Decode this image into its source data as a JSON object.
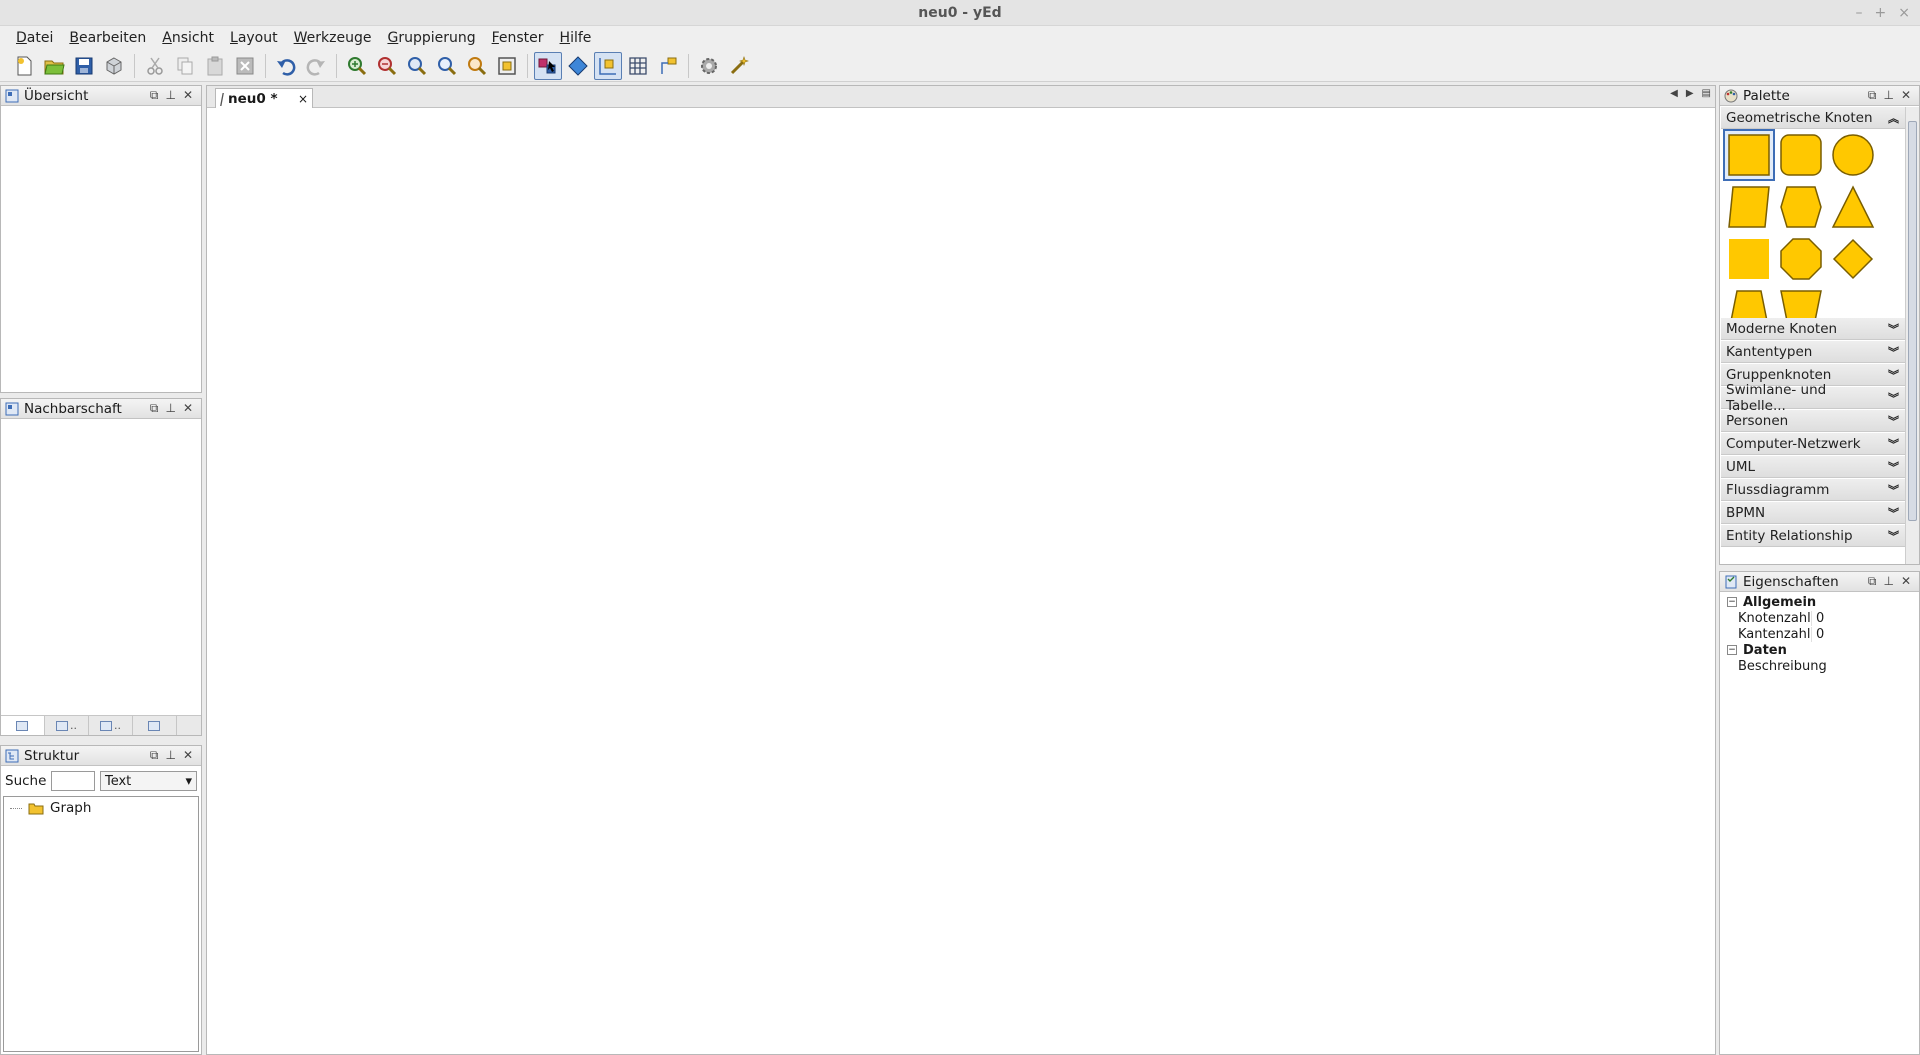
{
  "window": {
    "title": "neu0 - yEd",
    "controls": [
      "–",
      "+",
      "×"
    ]
  },
  "menu": [
    {
      "mn": "D",
      "rest": "atei"
    },
    {
      "mn": "B",
      "rest": "earbeiten"
    },
    {
      "mn": "A",
      "rest": "nsicht"
    },
    {
      "mn": "L",
      "rest": "ayout"
    },
    {
      "mn": "W",
      "rest": "erkzeuge"
    },
    {
      "mn": "G",
      "rest": "ruppierung"
    },
    {
      "mn": "F",
      "rest": "enster"
    },
    {
      "mn": "H",
      "rest": "ilfe"
    }
  ],
  "panels": {
    "overview": {
      "title": "Übersicht"
    },
    "neighborhood": {
      "title": "Nachbarschaft",
      "tabs": [
        "",
        "..",
        "..",
        ""
      ]
    },
    "structure": {
      "title": "Struktur",
      "search_label": "Suche",
      "search_value": "",
      "search_mode": "Text",
      "tree_root": "Graph"
    }
  },
  "editor": {
    "tab_label": "neu0 *",
    "tab_close": "×"
  },
  "palette": {
    "title": "Palette",
    "open_section": "Geometrische Knoten",
    "sections": [
      "Moderne Knoten",
      "Kantentypen",
      "Gruppenknoten",
      "Swimlane- und Tabelle...",
      "Personen",
      "Computer-Netzwerk",
      "UML",
      "Flussdiagramm",
      "BPMN",
      "Entity Relationship"
    ],
    "shape_fill": "#ffc800",
    "shape_stroke": "#7a5e00"
  },
  "properties": {
    "title": "Eigenschaften",
    "groups": [
      {
        "name": "Allgemein",
        "rows": [
          {
            "key": "Knotenzahl",
            "value": "0"
          },
          {
            "key": "Kantenzahl",
            "value": "0"
          }
        ]
      },
      {
        "name": "Daten",
        "rows": [
          {
            "key": "Beschreibung",
            "value": ""
          }
        ]
      }
    ]
  }
}
